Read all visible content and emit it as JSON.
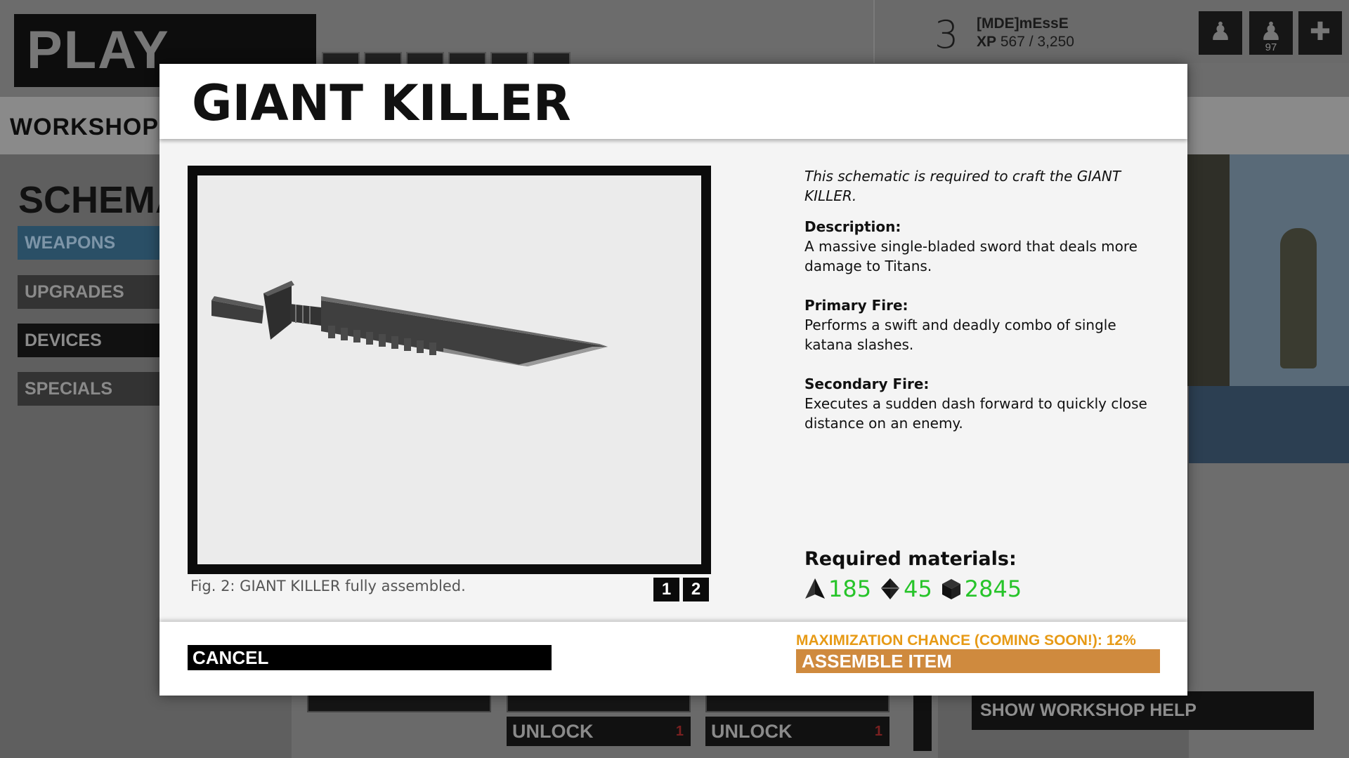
{
  "background": {
    "play_now": "PLAY NOW",
    "workshop": "WORKSHOP",
    "schema": "SCHEMA",
    "categories": [
      "WEAPONS",
      "UPGRADES",
      "DEVICES",
      "SPECIALS"
    ],
    "user": {
      "level": "3",
      "name": "[MDE]mEssE",
      "xp_label": "XP",
      "xp_value": "567 / 3,250"
    },
    "squad_count": "97",
    "unlock_label": "UNLOCK",
    "unlock_cost": "1",
    "show_help": "SHOW WORKSHOP HELP"
  },
  "modal": {
    "title": "GIANT KILLER",
    "figure": {
      "caption": "Fig. 2: GIANT KILLER fully assembled.",
      "pages": [
        "1",
        "2"
      ]
    },
    "intro": "This schematic is required to craft the GIANT KILLER.",
    "description_label": "Description:",
    "description": "A massive single-bladed sword that deals more damage to Titans.",
    "primary_label": "Primary Fire:",
    "primary": "Performs a swift and deadly combo of single katana slashes.",
    "secondary_label": "Secondary Fire:",
    "secondary": "Executes a sudden dash forward to quickly close distance on an enemy.",
    "materials_title": "Required materials:",
    "materials": [
      {
        "icon": "crystal-icon",
        "value": "185"
      },
      {
        "icon": "octahedron-icon",
        "value": "45"
      },
      {
        "icon": "cube-icon",
        "value": "2845"
      }
    ],
    "cancel": "CANCEL",
    "max_chance": "MAXIMIZATION CHANCE (COMING SOON!): 12%",
    "assemble": "ASSEMBLE ITEM"
  },
  "colors": {
    "material_green": "#27c42a",
    "accent_orange": "#e79a16",
    "assemble_bg": "#cf8a3e",
    "weapons_tab": "#2a4f66"
  }
}
